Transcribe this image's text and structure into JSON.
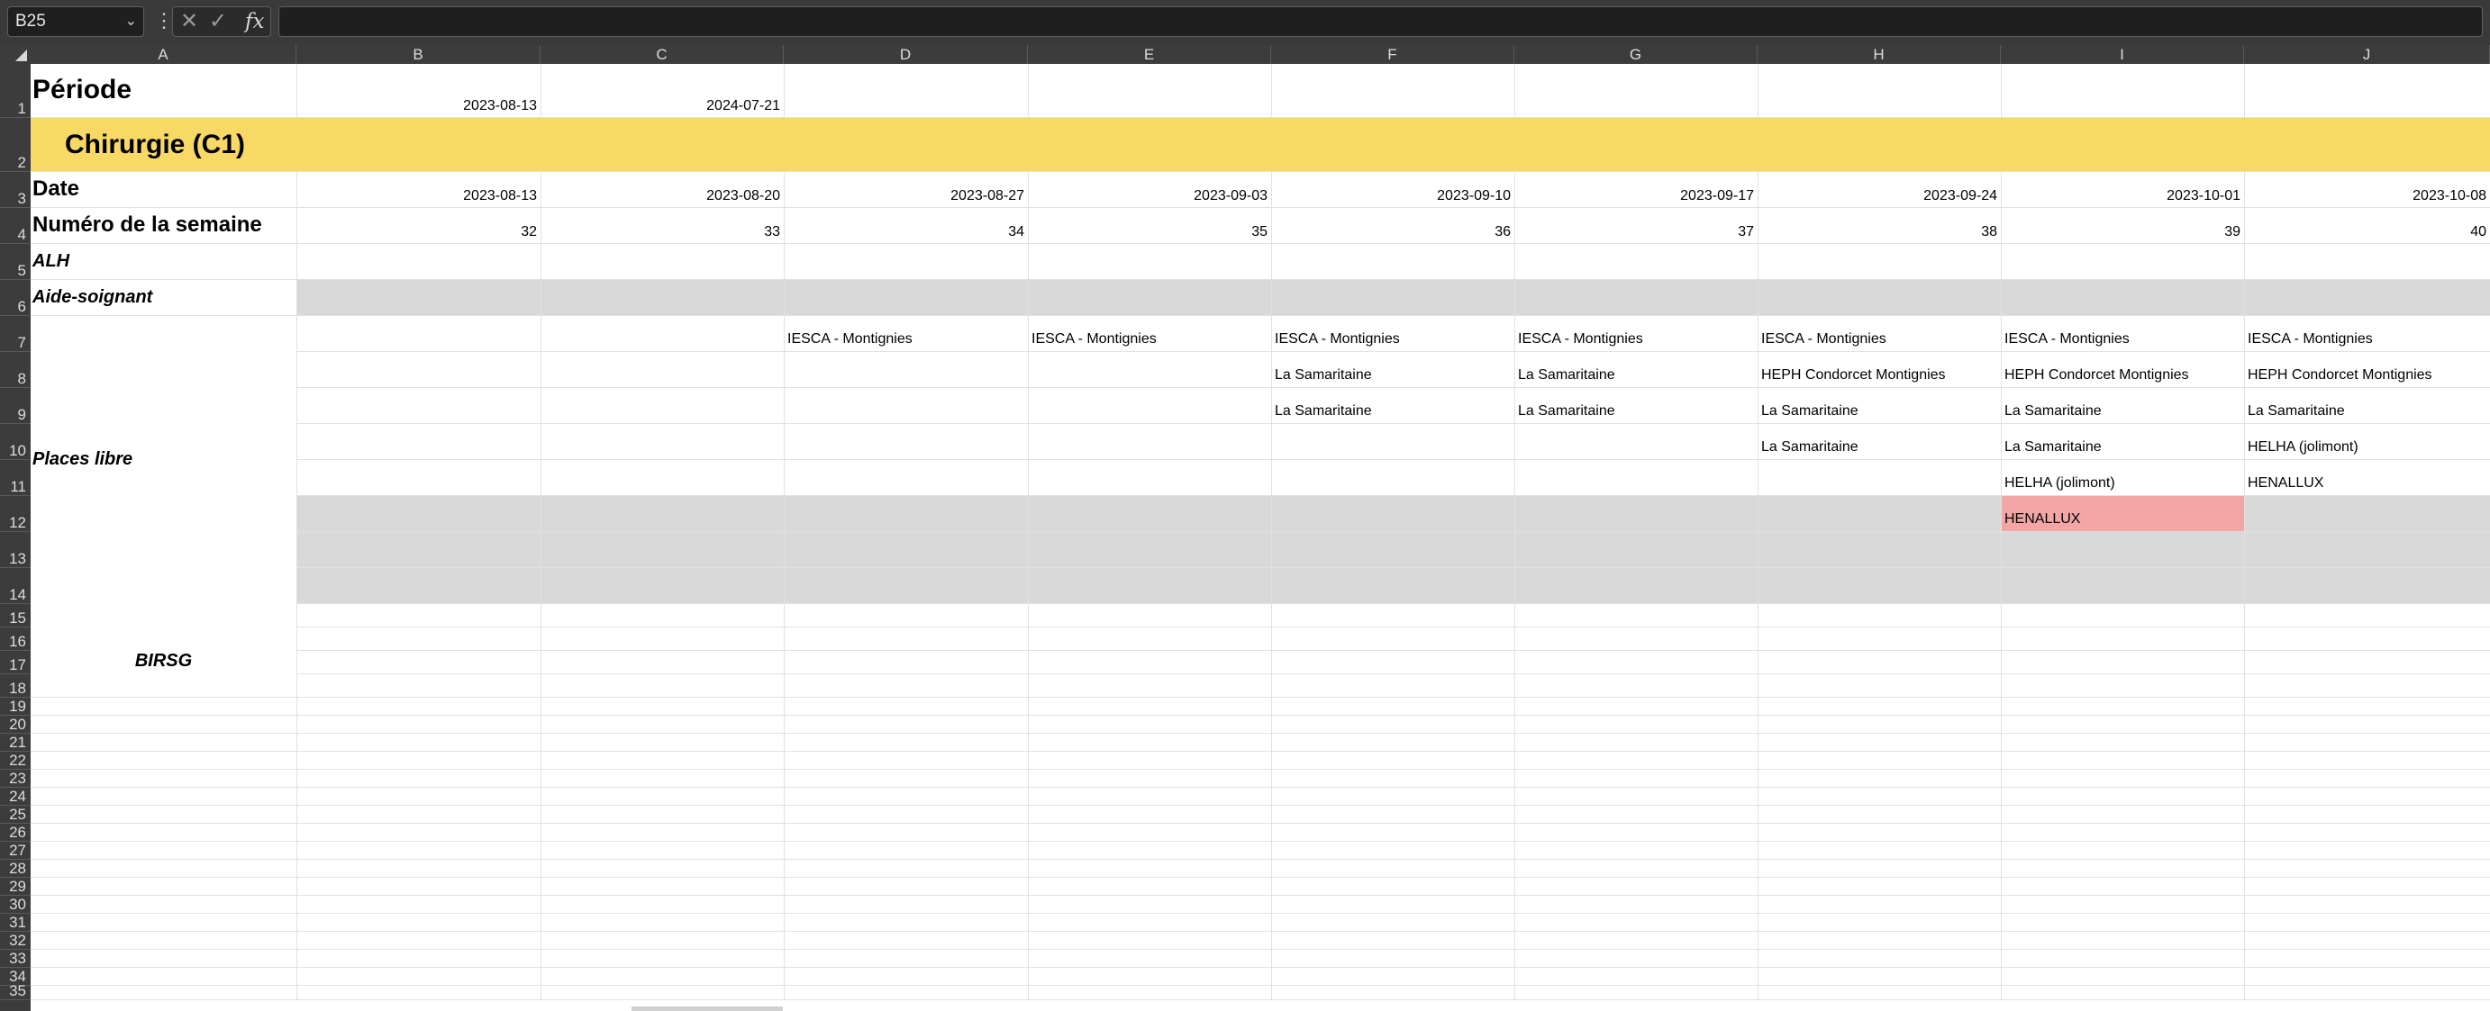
{
  "formula_bar": {
    "name_box": "B25",
    "dropdown_icon": "chevron-down-icon",
    "more_icon": "vertical-ellipsis-icon",
    "cancel_icon": "x-icon",
    "enter_icon": "check-icon",
    "function_icon": "fx",
    "formula": ""
  },
  "columns": [
    "A",
    "B",
    "C",
    "D",
    "E",
    "F",
    "G",
    "H",
    "I",
    "J"
  ],
  "rows": [
    "1",
    "2",
    "3",
    "4",
    "5",
    "6",
    "7",
    "8",
    "9",
    "10",
    "11",
    "12",
    "13",
    "14",
    "15",
    "16",
    "17",
    "18",
    "19",
    "20",
    "21",
    "22",
    "23",
    "24",
    "25",
    "26",
    "27",
    "28",
    "29",
    "30",
    "31",
    "32",
    "33",
    "34",
    "35"
  ],
  "sheet": {
    "periode": {
      "label": "Période",
      "start": "2023-08-13",
      "end": "2024-07-21"
    },
    "section_title": "Chirurgie (C1)",
    "date_label": "Date",
    "dates": [
      "2023-08-13",
      "2023-08-20",
      "2023-08-27",
      "2023-09-03",
      "2023-09-10",
      "2023-09-17",
      "2023-09-24",
      "2023-10-01",
      "2023-10-08"
    ],
    "week_label": "Numéro de la semaine",
    "weeks": [
      "32",
      "33",
      "34",
      "35",
      "36",
      "37",
      "38",
      "39",
      "40"
    ],
    "alh_label": "ALH",
    "aide_label": "Aide-soignant",
    "places_label": "Places libre",
    "birsg_label": "BIRSG",
    "places": {
      "D": [
        "IESCA - Montignies"
      ],
      "E": [
        "IESCA - Montignies"
      ],
      "F": [
        "IESCA - Montignies",
        "La Samaritaine",
        "La Samaritaine"
      ],
      "G": [
        "IESCA - Montignies",
        "La Samaritaine",
        "La Samaritaine"
      ],
      "H": [
        "IESCA - Montignies",
        "HEPH Condorcet Montignies",
        "La Samaritaine",
        "La Samaritaine"
      ],
      "I": [
        "IESCA - Montignies",
        "HEPH Condorcet Montignies",
        "La Samaritaine",
        "La Samaritaine",
        "HELHA (jolimont)",
        "HENALLUX"
      ],
      "J": [
        "IESCA - Montignies",
        "HEPH Condorcet Montignies",
        "La Samaritaine",
        "HELHA (jolimont)",
        "HENALLUX"
      ]
    },
    "colors": {
      "section_fill": "#f9d966",
      "gray_fill": "#d9d9d9",
      "highlight_fill": "#f4a6a6"
    }
  }
}
